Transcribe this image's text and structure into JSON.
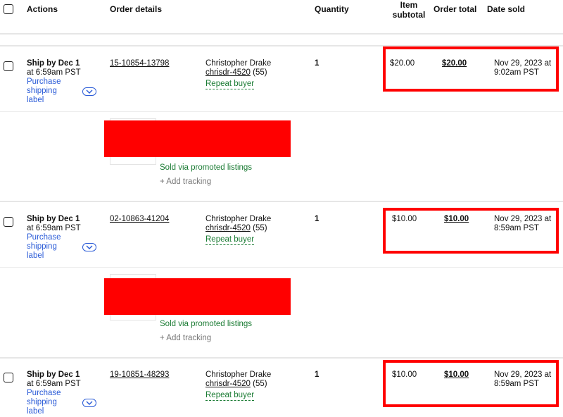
{
  "header": {
    "actions": "Actions",
    "order_details": "Order details",
    "quantity": "Quantity",
    "item_subtotal_1": "Item",
    "item_subtotal_2": "subtotal",
    "order_total": "Order total",
    "date_sold": "Date sold"
  },
  "colors": {
    "highlight": "#ff0000",
    "link": "#2a5bd7",
    "green": "#1a7b33"
  },
  "orders": [
    {
      "ship_by": "Ship by Dec 1",
      "ship_time": "at 6:59am PST",
      "purchase_1": "Purchase",
      "purchase_2": "shipping",
      "purchase_3": "label",
      "order_number": "15-10854-13798",
      "buyer_name": "Christopher Drake",
      "buyer_id": "chrisdr-4520",
      "feedback": "(55)",
      "repeat": "Repeat buyer",
      "quantity": "1",
      "item_subtotal": "$20.00",
      "order_total": "$20.00",
      "date_1": "Nov 29, 2023 at",
      "date_2": "9:02am PST",
      "promo": "Sold via promoted listings",
      "add_tracking": "+ Add tracking"
    },
    {
      "ship_by": "Ship by Dec 1",
      "ship_time": "at 6:59am PST",
      "purchase_1": "Purchase",
      "purchase_2": "shipping",
      "purchase_3": "label",
      "order_number": "02-10863-41204",
      "buyer_name": "Christopher Drake",
      "buyer_id": "chrisdr-4520",
      "feedback": "(55)",
      "repeat": "Repeat buyer",
      "quantity": "1",
      "item_subtotal": "$10.00",
      "order_total": "$10.00",
      "date_1": "Nov 29, 2023 at",
      "date_2": "8:59am PST",
      "promo": "Sold via promoted listings",
      "add_tracking": "+ Add tracking"
    },
    {
      "ship_by": "Ship by Dec 1",
      "ship_time": "at 6:59am PST",
      "purchase_1": "Purchase",
      "purchase_2": "shipping",
      "purchase_3": "label",
      "order_number": "19-10851-48293",
      "buyer_name": "Christopher Drake",
      "buyer_id": "chrisdr-4520",
      "feedback": "(55)",
      "repeat": "Repeat buyer",
      "quantity": "1",
      "item_subtotal": "$10.00",
      "order_total": "$10.00",
      "date_1": "Nov 29, 2023 at",
      "date_2": "8:59am PST"
    }
  ]
}
